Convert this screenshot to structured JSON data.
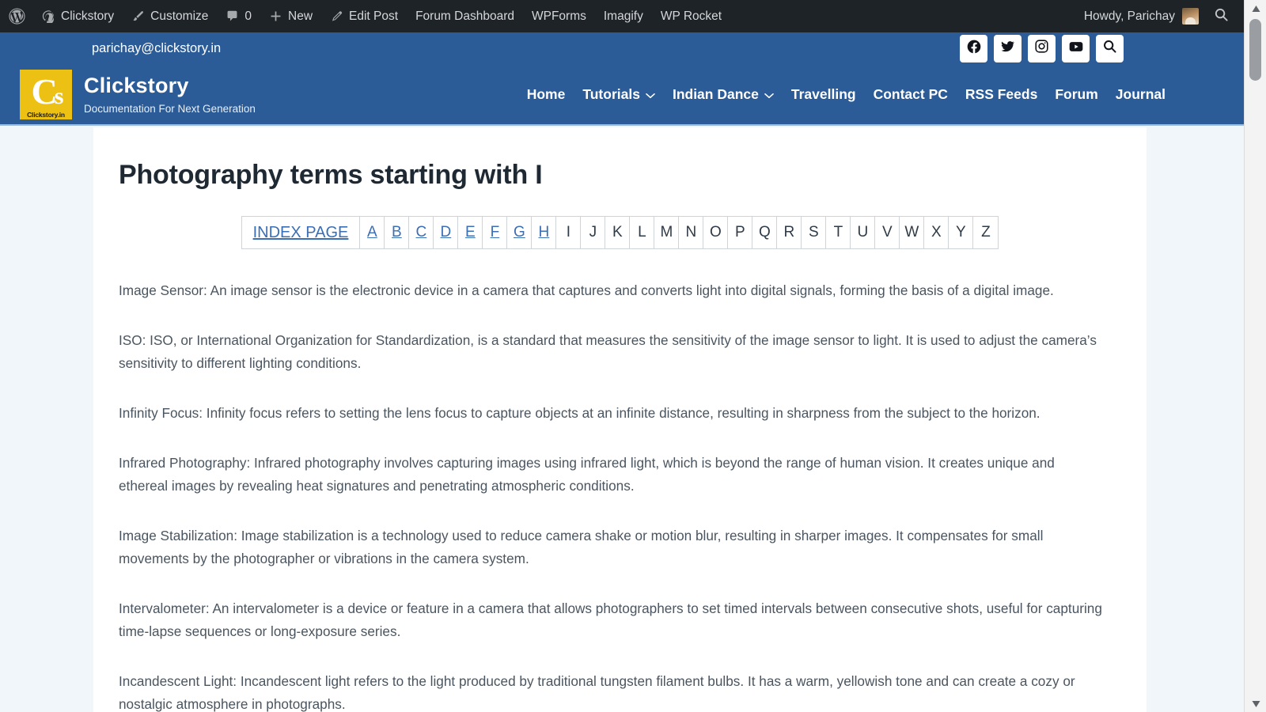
{
  "adminbar": {
    "wp_logo_icon": "wordpress-logo-icon",
    "items": [
      {
        "label": "Clickstory",
        "icon": "dashboard-icon"
      },
      {
        "label": "Customize",
        "icon": "paintbrush-icon"
      },
      {
        "label": "0",
        "icon": "comment-bubble-icon"
      },
      {
        "label": "New",
        "icon": "plus-icon"
      },
      {
        "label": "Edit Post",
        "icon": "pencil-icon"
      },
      {
        "label": "Forum Dashboard",
        "icon": ""
      },
      {
        "label": "WPForms",
        "icon": ""
      },
      {
        "label": "Imagify",
        "icon": ""
      },
      {
        "label": "WP Rocket",
        "icon": ""
      }
    ],
    "howdy": "Howdy, Parichay",
    "search_icon": "search-icon"
  },
  "topbar": {
    "email": "parichay@clickstory.in",
    "social": [
      {
        "name": "facebook-icon",
        "label": "Facebook"
      },
      {
        "name": "twitter-icon",
        "label": "Twitter"
      },
      {
        "name": "instagram-icon",
        "label": "Instagram"
      },
      {
        "name": "youtube-icon",
        "label": "YouTube"
      },
      {
        "name": "search-icon",
        "label": "Search"
      }
    ]
  },
  "header": {
    "logo_mono_c": "C",
    "logo_mono_s": "s",
    "logo_caption": "Clickstory.in",
    "site_title": "Clickstory",
    "tagline": "Documentation For Next Generation",
    "nav": [
      {
        "label": "Home",
        "dropdown": false
      },
      {
        "label": "Tutorials",
        "dropdown": true
      },
      {
        "label": "Indian Dance",
        "dropdown": true
      },
      {
        "label": "Travelling",
        "dropdown": false
      },
      {
        "label": "Contact PC",
        "dropdown": false
      },
      {
        "label": "RSS Feeds",
        "dropdown": false
      },
      {
        "label": "Forum",
        "dropdown": false
      },
      {
        "label": "Journal",
        "dropdown": false
      }
    ]
  },
  "main": {
    "title": "Photography terms starting with I",
    "index": {
      "page_label": "INDEX PAGE",
      "letters": [
        {
          "letter": "A",
          "link": true
        },
        {
          "letter": "B",
          "link": true
        },
        {
          "letter": "C",
          "link": true
        },
        {
          "letter": "D",
          "link": true
        },
        {
          "letter": "E",
          "link": true
        },
        {
          "letter": "F",
          "link": true
        },
        {
          "letter": "G",
          "link": true
        },
        {
          "letter": "H",
          "link": true
        },
        {
          "letter": "I",
          "link": false
        },
        {
          "letter": "J",
          "link": false
        },
        {
          "letter": "K",
          "link": false
        },
        {
          "letter": "L",
          "link": false
        },
        {
          "letter": "M",
          "link": false
        },
        {
          "letter": "N",
          "link": false
        },
        {
          "letter": "O",
          "link": false
        },
        {
          "letter": "P",
          "link": false
        },
        {
          "letter": "Q",
          "link": false
        },
        {
          "letter": "R",
          "link": false
        },
        {
          "letter": "S",
          "link": false
        },
        {
          "letter": "T",
          "link": false
        },
        {
          "letter": "U",
          "link": false
        },
        {
          "letter": "V",
          "link": false
        },
        {
          "letter": "W",
          "link": false
        },
        {
          "letter": "X",
          "link": false
        },
        {
          "letter": "Y",
          "link": false
        },
        {
          "letter": "Z",
          "link": false
        }
      ]
    },
    "paragraphs": [
      "Image Sensor: An image sensor is the electronic device in a camera that captures and converts light into digital signals, forming the basis of a digital image.",
      "ISO: ISO, or International Organization for Standardization, is a standard that measures the sensitivity of the image sensor to light. It is used to adjust the camera’s sensitivity to different lighting conditions.",
      "Infinity Focus: Infinity focus refers to setting the lens focus to capture objects at an infinite distance, resulting in sharpness from the subject to the horizon.",
      "Infrared Photography: Infrared photography involves capturing images using infrared light, which is beyond the range of human vision. It creates unique and ethereal images by revealing heat signatures and penetrating atmospheric conditions.",
      "Image Stabilization: Image stabilization is a technology used to reduce camera shake or motion blur, resulting in sharper images. It compensates for small movements by the photographer or vibrations in the camera system.",
      "Intervalometer: An intervalometer is a device or feature in a camera that allows photographers to set timed intervals between consecutive shots, useful for capturing time-lapse sequences or long-exposure series.",
      "Incandescent Light: Incandescent light refers to the light produced by traditional tungsten filament bulbs. It has a warm, yellowish tone and can create a cozy or nostalgic atmosphere in photographs."
    ]
  },
  "colors": {
    "brand_blue": "#2c5c97",
    "admin_dark": "#1d2327",
    "logo_gold": "#edc114",
    "link_blue": "#3a6fb5",
    "page_bg": "#f1f6fa"
  }
}
